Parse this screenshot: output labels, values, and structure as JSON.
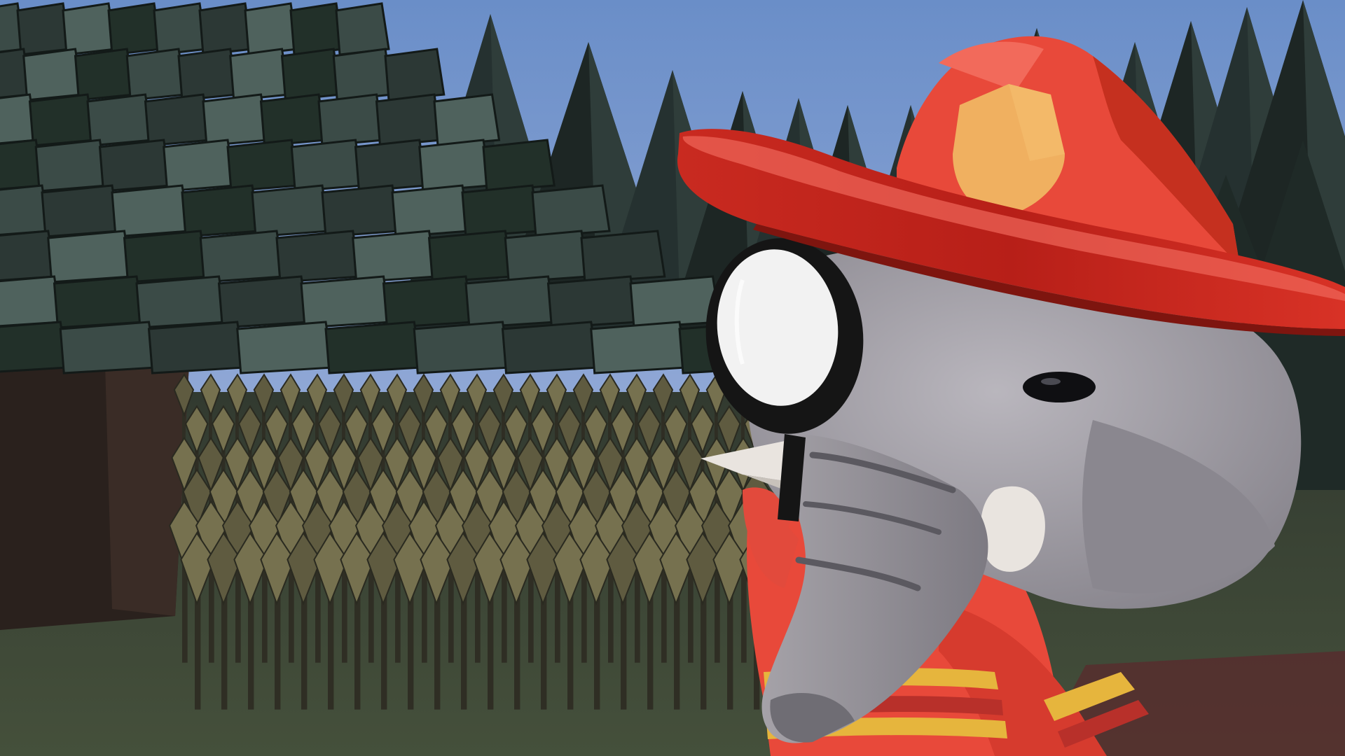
{
  "scene": {
    "setting": "pine-forest-clearing",
    "character": "elephant-firefighter",
    "held_item": "magnifying-glass",
    "hud_text": []
  },
  "palette": {
    "sky": "#6b8fc7",
    "sky_horizon": "#8fa9d6",
    "pine_dark": "#1f2a27",
    "pine_mid": "#2f3f3b",
    "pine_light": "#5b6f69",
    "trunk": "#2a211d",
    "ground": "#3d4736",
    "ground_dark": "#2a3226",
    "wheat": "#76714f",
    "wheat_shadow": "#3b3a2c",
    "helmet_red": "#e23b2b",
    "helmet_dark": "#a81f17",
    "badge": "#f0b060",
    "elephant_gray": "#9c9aa0",
    "elephant_light": "#b7b4ba",
    "elephant_dark": "#6f6d74",
    "tusk": "#e9e4df",
    "lens_frame": "#151515",
    "lens_glass": "#f2f2f2",
    "suit_red": "#e8493a",
    "stripe_yellow": "#e6b53d"
  }
}
